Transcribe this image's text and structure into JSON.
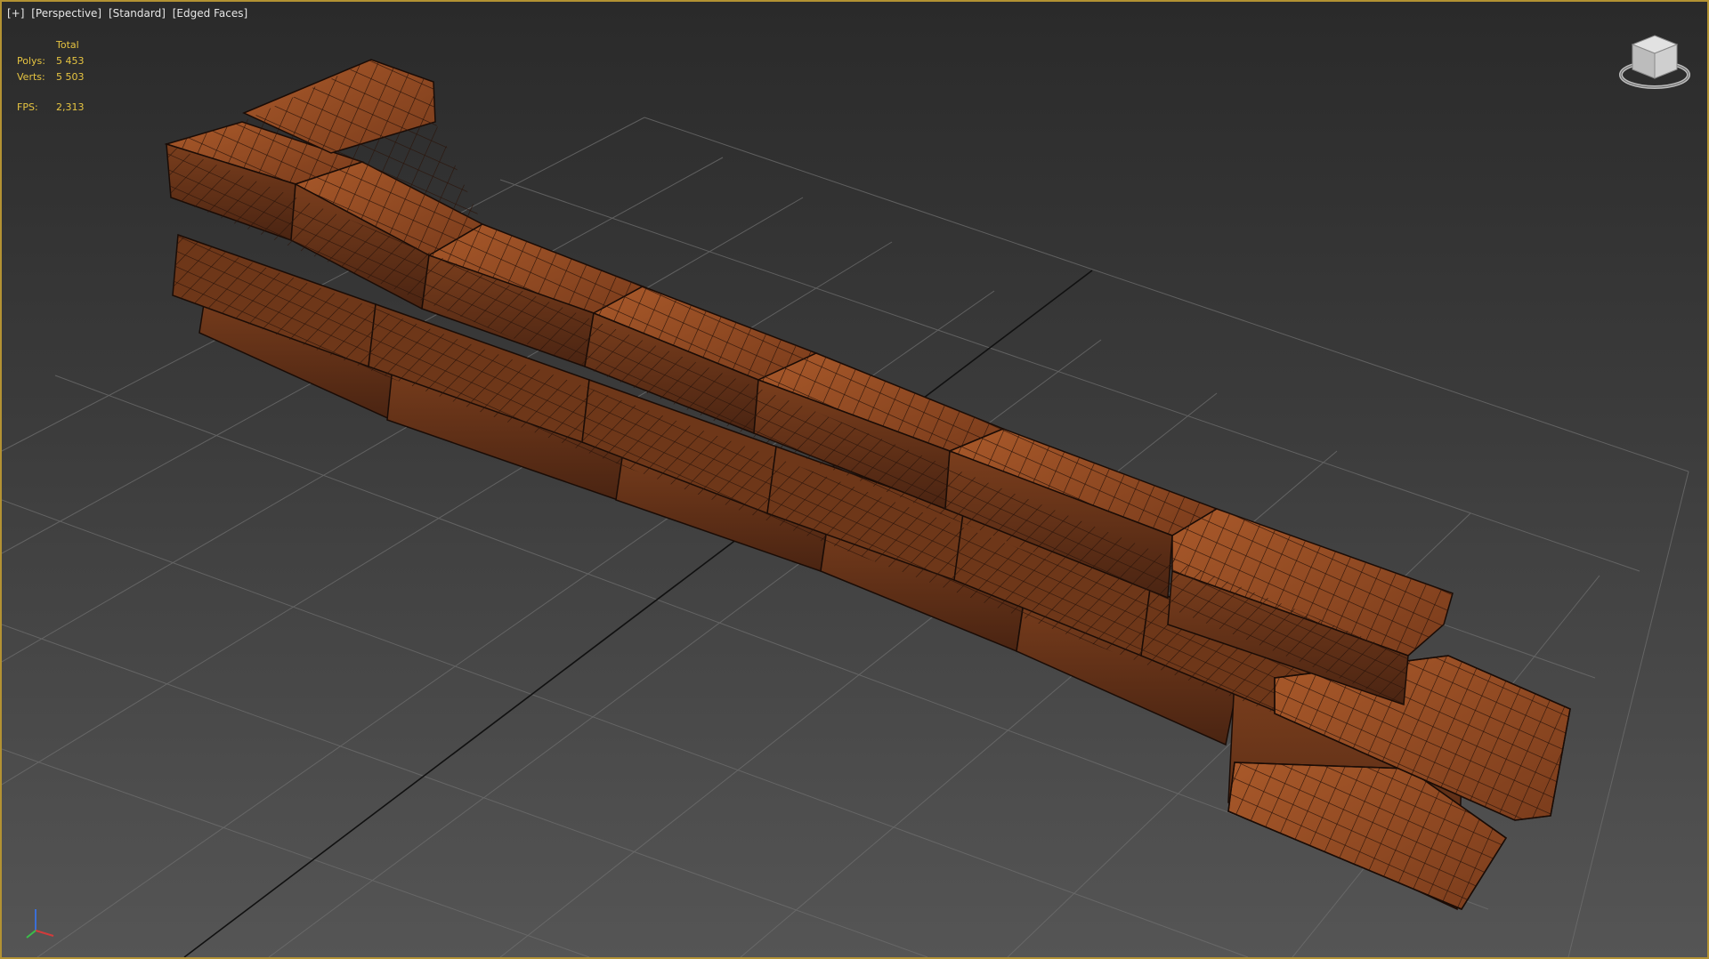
{
  "viewport": {
    "menu": {
      "plus": "[+]",
      "view": "[Perspective]",
      "shading": "[Standard]",
      "display": "[Edged Faces]"
    },
    "stats": {
      "total_label": "Total",
      "polys_label": "Polys:",
      "polys_value": "5 453",
      "verts_label": "Verts:",
      "verts_value": "5 503",
      "fps_label": "FPS:",
      "fps_value": "2,313"
    },
    "gizmos": [
      "viewcube-icon",
      "axis-tripod-icon"
    ],
    "colors": {
      "frame_border": "#b39233",
      "stats_text": "#e6c441",
      "brick": "#8a4a22",
      "grid": "#6a6a6a"
    }
  }
}
